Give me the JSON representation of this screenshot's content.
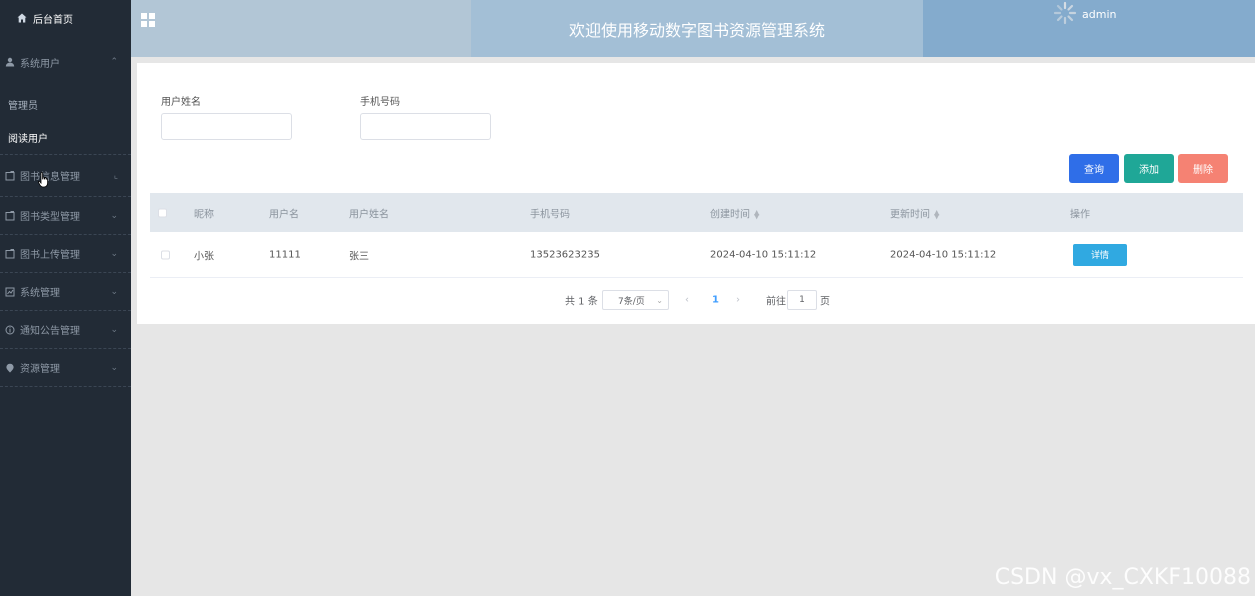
{
  "sidebar": {
    "home": "后台首页",
    "system_users": {
      "label": "系统用户",
      "children": [
        "管理员",
        "阅读用户"
      ]
    },
    "items": [
      {
        "label": "图书信息管理",
        "icon": "doc-icon"
      },
      {
        "label": "图书类型管理",
        "icon": "doc-icon"
      },
      {
        "label": "图书上传管理",
        "icon": "doc-icon"
      },
      {
        "label": "系统管理",
        "icon": "chart-icon"
      },
      {
        "label": "通知公告管理",
        "icon": "info-icon"
      },
      {
        "label": "资源管理",
        "icon": "pin-icon"
      }
    ]
  },
  "header": {
    "title": "欢迎使用移动数字图书资源管理系统",
    "user": "admin"
  },
  "filters": {
    "name_label": "用户姓名",
    "phone_label": "手机号码",
    "name_value": "",
    "phone_value": ""
  },
  "actions": {
    "query": "查询",
    "add": "添加",
    "delete": "删除"
  },
  "table": {
    "columns": [
      "昵称",
      "用户名",
      "用户姓名",
      "手机号码",
      "创建时间",
      "更新时间",
      "操作"
    ],
    "rows": [
      {
        "nickname": "小张",
        "username": "11111",
        "realname": "张三",
        "phone": "13523623235",
        "created": "2024-04-10 15:11:12",
        "updated": "2024-04-10 15:11:12",
        "action": "详情"
      }
    ]
  },
  "pagination": {
    "total": "共 1 条",
    "page_size": "7条/页",
    "current_page": "1",
    "goto_label": "前往",
    "goto_value": "1",
    "page_suffix": "页"
  },
  "watermark": "CSDN @vx_CXKF10088",
  "colors": {
    "sidebar_bg": "#222b36",
    "query_btn": "#2f6ee8",
    "add_btn": "#1fa797",
    "delete_btn": "#f58273",
    "detail_btn": "#30a9e1"
  }
}
